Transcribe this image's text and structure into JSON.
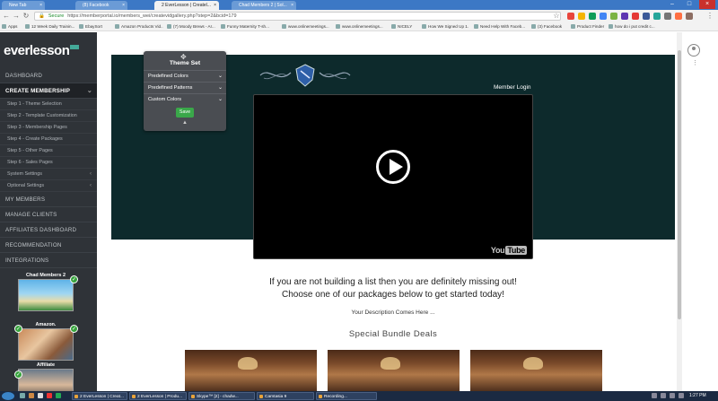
{
  "browser": {
    "tabs": [
      {
        "label": "New Tab",
        "active": false
      },
      {
        "label": "(8) Facebook",
        "active": false
      },
      {
        "label": "2 EverLesson | Createl...",
        "active": true
      },
      {
        "label": "Chad Members 2 | Sol...",
        "active": false
      }
    ],
    "secure_label": "Secure",
    "url": "https://memberportal.io/members_wei/createvidgallery.php?step=2&bcid=179",
    "bookmarks": [
      "Apps",
      "12 Week Daily Trainin...",
      "EbaySort",
      "Amazon Products Vid...",
      "(7) Moody Brews - Ar...",
      "Funny Maternity T-sh...",
      "www.onlinemeetings...",
      "www.onlinemeetings...",
      "NICELY",
      "How We Signed Up 1...",
      "Need Help With Faceb...",
      "(3) Facebook",
      "Product Finder",
      "how do i put credit c..."
    ]
  },
  "sidebar": {
    "logo_text": "everlesson",
    "menu": [
      {
        "label": "DASHBOARD",
        "active": false
      },
      {
        "label": "CREATE MEMBERSHIP",
        "active": true
      }
    ],
    "sub_items": [
      {
        "label": "Step 1 - Theme Selection"
      },
      {
        "label": "Step 2 - Template Customization"
      },
      {
        "label": "Step 3 - Membership Pages"
      },
      {
        "label": "Step 4 - Create Packages"
      },
      {
        "label": "Step 5 - Other Pages"
      },
      {
        "label": "Step 6 - Sales Pages"
      },
      {
        "label": "System Settings"
      },
      {
        "label": "Optional Settings"
      }
    ],
    "menu2": [
      {
        "label": "MY MEMBERS"
      },
      {
        "label": "MANAGE CLIENTS"
      },
      {
        "label": "AFFILIATES DASHBOARD"
      },
      {
        "label": "RECOMMENDATION"
      },
      {
        "label": "INTEGRATIONS"
      }
    ],
    "packages": [
      {
        "label": "Chad Members 2"
      },
      {
        "label": "Amazon."
      },
      {
        "label": "Affiliate"
      }
    ]
  },
  "theme_panel": {
    "title": "Theme Set",
    "rows": [
      "Predefined Colors",
      "Predefined Patterns",
      "Custom Colors"
    ],
    "save_label": "Save"
  },
  "main": {
    "member_login": "Member Login",
    "video_brand_you": "You",
    "video_brand_tube": "Tube",
    "headline_1": "If you are not building a list then you are definitely missing out!",
    "headline_2": "Choose one of our packages below to get started today!",
    "description": "Your Description Comes Here ...",
    "special": "Special Bundle Deals"
  },
  "taskbar": {
    "tasks": [
      {
        "label": "2 EverLesson | Creat...",
        "active": false
      },
      {
        "label": "2 EverLesson | Produ...",
        "active": false
      },
      {
        "label": "Skype™ [2] - chadw...",
        "active": false
      },
      {
        "label": "Camtasia 9",
        "active": false
      },
      {
        "label": "Recording...",
        "active": false
      }
    ],
    "clock": "1:27 PM"
  }
}
